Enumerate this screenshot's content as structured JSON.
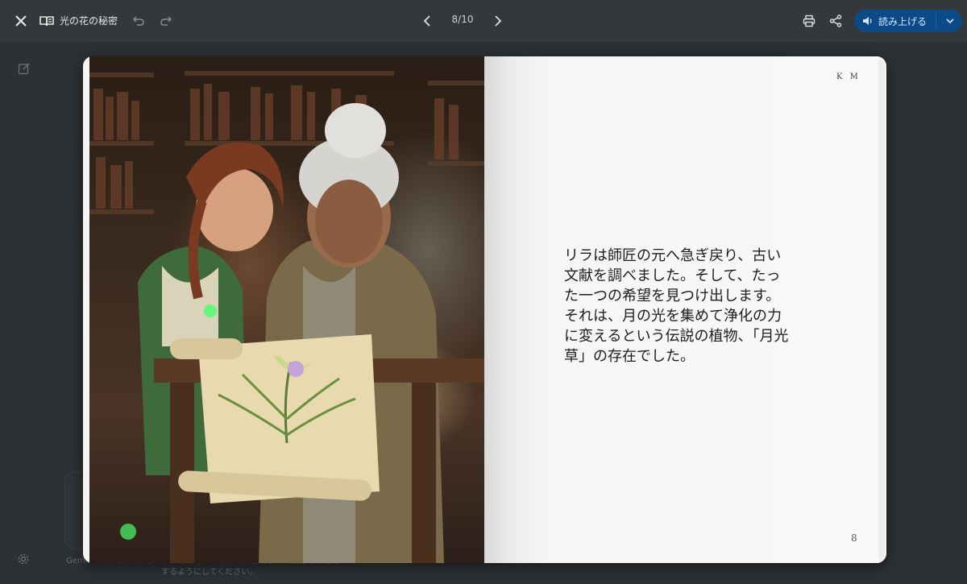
{
  "header": {
    "title": "光の花の秘密",
    "page_indicator": "8/10",
    "read_aloud_label": "読み上げる"
  },
  "icons": {
    "close": "close-icon",
    "book": "book-icon",
    "undo": "undo-icon",
    "redo": "redo-icon",
    "prev": "chevron-left-icon",
    "next": "chevron-right-icon",
    "print": "print-icon",
    "share": "share-icon",
    "speaker": "speaker-icon",
    "dropdown": "chevron-down-icon",
    "edit": "edit-icon",
    "settings": "gear-icon"
  },
  "book": {
    "illustration_alt": "",
    "initials": "K M",
    "story_lines": [
      "リラは師匠の元へ急ぎ戻り、古い",
      "文献を調べました。そして、たっ",
      "た一つの希望を見つけ出します。",
      "それは、月の光を集めて浄化の力",
      "に変えるという伝説の植物、「月光",
      "草」の存在でした。"
    ],
    "page_number": "8"
  },
  "background": {
    "footer_line1": "Gemini 不正確な情報を表示することがあるため、生成された回答を再確認",
    "footer_line2": "するようにしてください。"
  },
  "colors": {
    "app_bg": "#2e3134",
    "topbar_bg": "#35383b",
    "accent": "#0b4a86"
  }
}
